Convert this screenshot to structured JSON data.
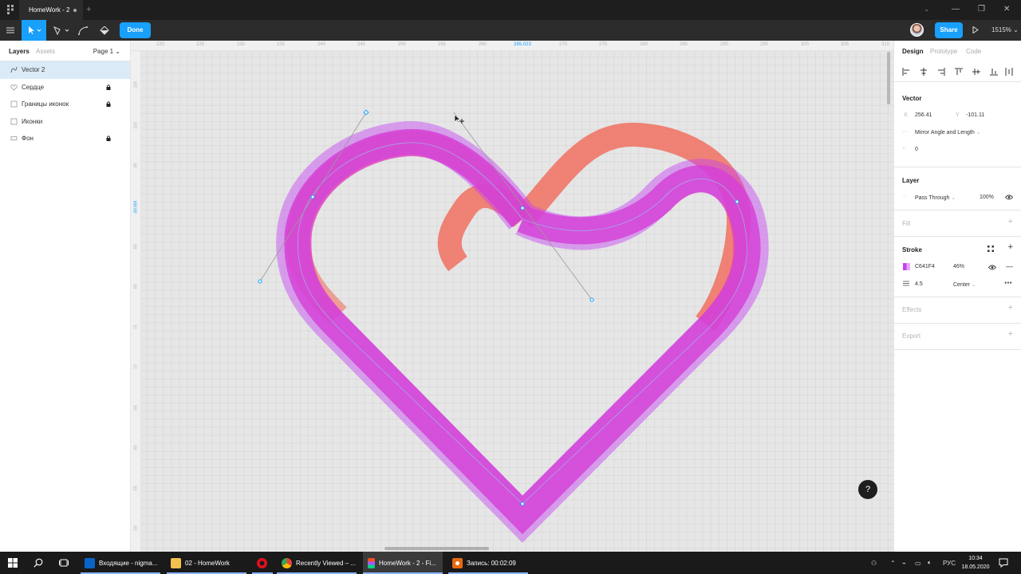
{
  "window": {
    "doc_tab_title": "HomeWork - 2"
  },
  "toolbar": {
    "done_label": "Done",
    "share_label": "Share",
    "zoom_label": "1515%"
  },
  "left_panel": {
    "tab_layers": "Layers",
    "tab_assets": "Assets",
    "page_selector": "Page 1",
    "layers": [
      {
        "name": "Vector 2",
        "icon": "vector-icon",
        "selected": true,
        "locked": false
      },
      {
        "name": "Сердце",
        "icon": "heart-icon",
        "selected": false,
        "locked": true
      },
      {
        "name": "Границы иконок",
        "icon": "frame-icon",
        "selected": false,
        "locked": true
      },
      {
        "name": "Иконки",
        "icon": "frame-icon",
        "selected": false,
        "locked": false
      },
      {
        "name": "Фон",
        "icon": "rectangle-icon",
        "selected": false,
        "locked": true
      }
    ]
  },
  "canvas": {
    "ruler_top": [
      "220",
      "225",
      "230",
      "235",
      "240",
      "245",
      "250",
      "255",
      "260",
      "265.023",
      "270",
      "275",
      "280",
      "285",
      "290",
      "295",
      "300",
      "305",
      "310"
    ],
    "ruler_top_highlight": "265.023",
    "ruler_left": [
      "-105",
      "-100",
      "-95",
      "-89.894",
      "-85",
      "-80",
      "-75",
      "-70",
      "-65",
      "-60",
      "-55",
      "-50"
    ],
    "ruler_left_highlight": "-89.894",
    "help_label": "?"
  },
  "right_panel": {
    "tab_design": "Design",
    "tab_prototype": "Prototype",
    "tab_code": "Code",
    "vector": {
      "title": "Vector",
      "x_label": "X",
      "x_value": "256.41",
      "y_label": "Y",
      "y_value": "-101.11",
      "mirror_mode": "Mirror Angle and Length",
      "corner_radius": "0"
    },
    "layer": {
      "title": "Layer",
      "blend_mode": "Pass Through",
      "opacity": "100%"
    },
    "fill": {
      "title": "Fill"
    },
    "stroke": {
      "title": "Stroke",
      "color_hex": "C641F4",
      "color": "#C641F4",
      "opacity": "46%",
      "weight": "4.5",
      "position": "Center"
    },
    "effects": {
      "title": "Effects"
    },
    "export": {
      "title": "Export"
    }
  },
  "taskbar": {
    "items": [
      {
        "label": "Входящие - nigma...",
        "icon": "outlook-icon"
      },
      {
        "label": "02 - HomeWork",
        "icon": "folder-icon"
      },
      {
        "label": "",
        "icon": "opera-icon"
      },
      {
        "label": "Recently Viewed – ...",
        "icon": "chrome-icon"
      },
      {
        "label": "HomeWork - 2 - Fi...",
        "icon": "figma-icon"
      },
      {
        "label": "Запись: 00:02:09",
        "icon": "record-icon"
      }
    ],
    "language": "РУС",
    "time": "10:34",
    "date": "18.05.2020"
  },
  "colors": {
    "accent": "#18a0fb",
    "heart_orange": "#f07060",
    "heart_magenta": "#e040c0",
    "stroke_purple": "#C641F4"
  }
}
